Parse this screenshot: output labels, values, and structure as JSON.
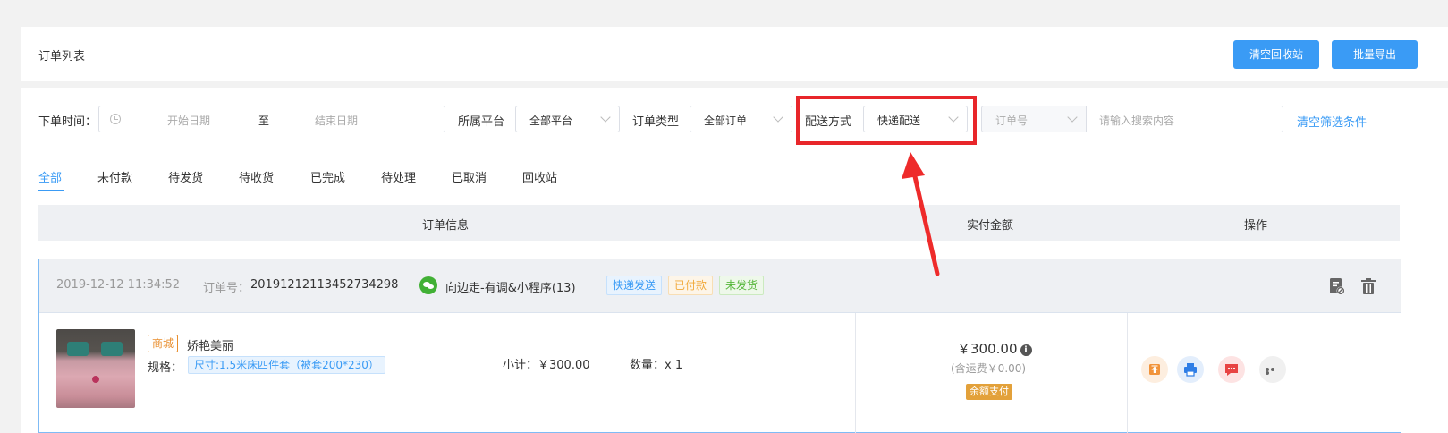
{
  "header": {
    "title": "订单列表",
    "btn_clear_recycle": "清空回收站",
    "btn_export": "批量导出"
  },
  "filters": {
    "order_time_label": "下单时间：",
    "start_placeholder": "开始日期",
    "to_label": "至",
    "end_placeholder": "结束日期",
    "platform_label": "所属平台",
    "platform_value": "全部平台",
    "type_label": "订单类型",
    "type_value": "全部订单",
    "delivery_label": "配送方式",
    "delivery_value": "快递配送",
    "search_field_value": "订单号",
    "search_placeholder": "请输入搜索内容",
    "clear_filters": "清空筛选条件"
  },
  "tabs": [
    "全部",
    "未付款",
    "待发货",
    "待收货",
    "已完成",
    "待处理",
    "已取消",
    "回收站"
  ],
  "active_tab": 0,
  "table_headers": {
    "order_info": "订单信息",
    "amount": "实付金额",
    "action": "操作"
  },
  "order": {
    "time": "2019-12-12 11:34:52",
    "order_no_label": "订单号：",
    "order_no": "20191212113452734298",
    "store": "向边走-有调&小程序(13)",
    "tags": [
      "快递发送",
      "已付款",
      "未发货"
    ],
    "product": {
      "badge": "商城",
      "name": "娇艳美丽",
      "spec_label": "规格：",
      "spec": "尺寸:1.5米床四件套（被套200*230）",
      "subtotal": "小计：￥300.00",
      "quantity": "数量：x 1"
    },
    "amount": "￥300.00",
    "shipping": "(含运费￥0.00)",
    "pay_method": "余额支付"
  },
  "colors": {
    "primary": "#3a9bf5",
    "highlight": "#e8262a"
  }
}
